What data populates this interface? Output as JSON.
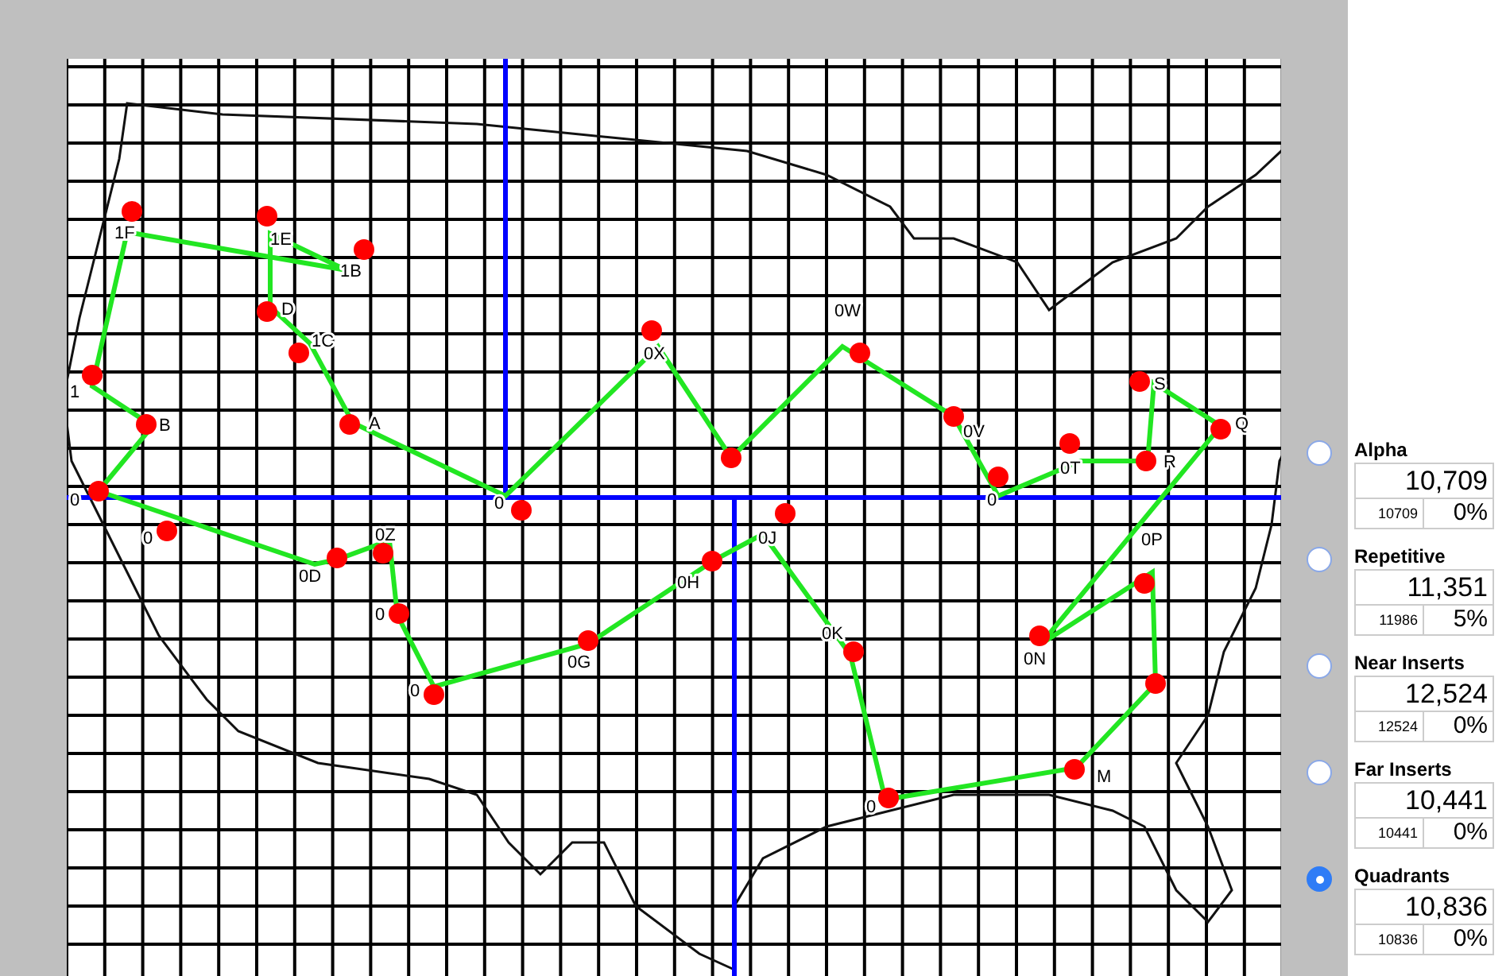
{
  "map": {
    "labels": [
      {
        "text": "1F"
      },
      {
        "text": "1E"
      },
      {
        "text": "1B"
      },
      {
        "text": "D"
      },
      {
        "text": "1C"
      },
      {
        "text": "1"
      },
      {
        "text": "B"
      },
      {
        "text": "A"
      },
      {
        "text": "0"
      },
      {
        "text": "0"
      },
      {
        "text": "0"
      },
      {
        "text": "0D"
      },
      {
        "text": "0Z"
      },
      {
        "text": "0"
      },
      {
        "text": "0"
      },
      {
        "text": "0G"
      },
      {
        "text": "0H"
      },
      {
        "text": "0J"
      },
      {
        "text": "0K"
      },
      {
        "text": "0"
      },
      {
        "text": "0X"
      },
      {
        "text": "0W"
      },
      {
        "text": "0V"
      },
      {
        "text": "0"
      },
      {
        "text": "0T"
      },
      {
        "text": "S"
      },
      {
        "text": "R"
      },
      {
        "text": "Q"
      },
      {
        "text": "0P"
      },
      {
        "text": "0N"
      },
      {
        "text": "M"
      }
    ]
  },
  "options": [
    {
      "name": "Alpha",
      "value": "10,709",
      "raw": "10709",
      "percent": "0%",
      "selected": false
    },
    {
      "name": "Repetitive",
      "value": "11,351",
      "raw": "11986",
      "percent": "5%",
      "selected": false
    },
    {
      "name": "Near Inserts",
      "value": "12,524",
      "raw": "12524",
      "percent": "0%",
      "selected": false
    },
    {
      "name": "Far Inserts",
      "value": "10,441",
      "raw": "10441",
      "percent": "0%",
      "selected": false
    },
    {
      "name": "Quadrants",
      "value": "10,836",
      "raw": "10836",
      "percent": "0%",
      "selected": true
    }
  ]
}
